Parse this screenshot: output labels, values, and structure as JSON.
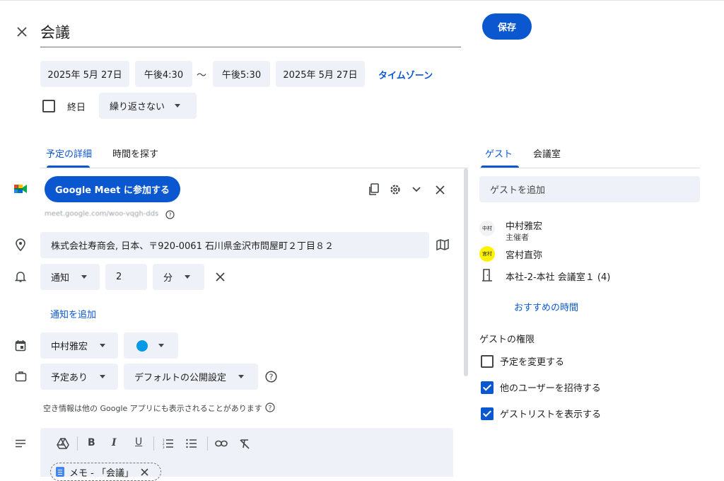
{
  "header": {
    "title": "会議",
    "save_label": "保存"
  },
  "datetime": {
    "start_date": "2025年 5月 27日",
    "start_time": "午後4:30",
    "separator": "〜",
    "end_time": "午後5:30",
    "end_date": "2025年 5月 27日",
    "timezone_label": "タイムゾーン",
    "all_day_label": "終日",
    "repeat_value": "繰り返さない"
  },
  "tabs": {
    "details": "予定の詳細",
    "find_time": "時間を探す"
  },
  "meet": {
    "join_button": "Google Meet に参加する",
    "link_text": "meet.google.com/woo-vqgh-dds"
  },
  "location": {
    "value": "株式会社寿商会, 日本、〒920-0061 石川県金沢市問屋町２丁目８２"
  },
  "notification": {
    "type": "通知",
    "amount": "2",
    "unit": "分",
    "add_label": "通知を追加"
  },
  "calendar": {
    "owner": "中村雅宏",
    "color": "#039be5"
  },
  "availability": {
    "busy": "予定あり",
    "visibility": "デフォルトの公開設定",
    "note": "空き情報は他の Google アプリにも表示されることがあります"
  },
  "editor": {
    "toolbar": [
      "B",
      "I",
      "U"
    ],
    "attachment_chip": "メモ - 「会議」"
  },
  "right_panel": {
    "tab_guests": "ゲスト",
    "tab_rooms": "会議室",
    "add_guest_placeholder": "ゲストを追加",
    "guests": [
      {
        "name": "中村雅宏",
        "role": "主催者",
        "avatar_text": "中村",
        "avatar_color": "#f1f3f4"
      },
      {
        "name": "宮村直弥",
        "role": "",
        "avatar_text": "宮村",
        "avatar_color": "#fff200"
      }
    ],
    "room": "本社-2-本社 会議室１ (4)",
    "suggested_times": "おすすめの時間",
    "permissions_title": "ゲストの権限",
    "permissions": [
      {
        "label": "予定を変更する",
        "checked": false
      },
      {
        "label": "他のユーザーを招待する",
        "checked": true
      },
      {
        "label": "ゲストリストを表示する",
        "checked": true
      }
    ]
  },
  "colors": {
    "accent": "#0b57d0",
    "chip_bg": "#eef1f7",
    "text": "#1f1f1f"
  }
}
